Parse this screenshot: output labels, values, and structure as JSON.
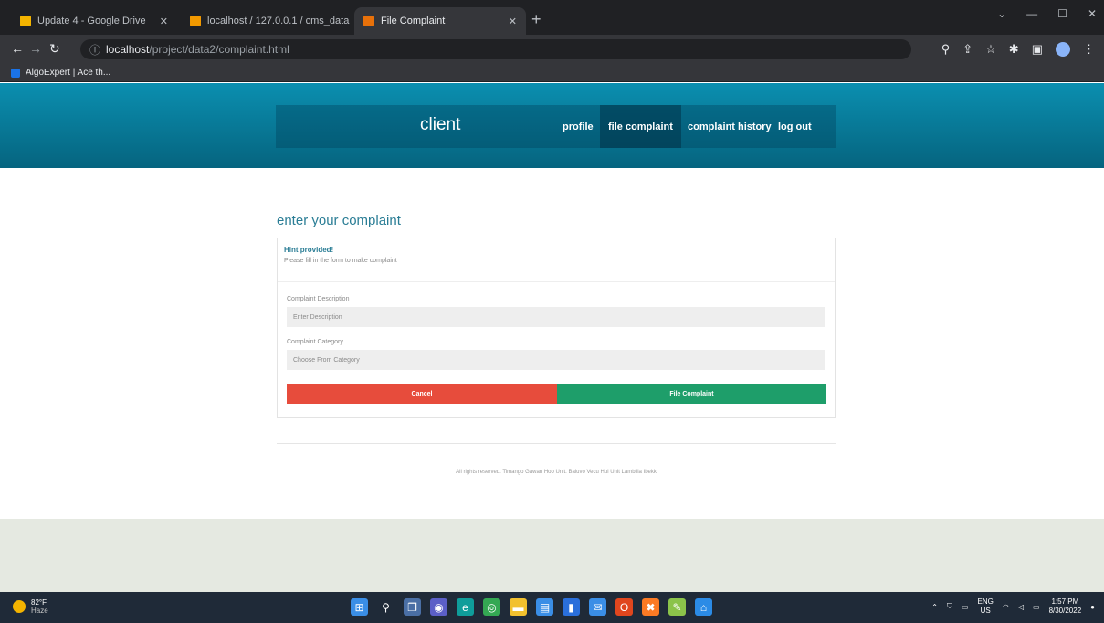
{
  "browser": {
    "tabs": [
      {
        "title": "Update 4 - Google Drive",
        "fav_color": "#f4b400"
      },
      {
        "title": "localhost / 127.0.0.1 / cms_data / ...",
        "fav_color": "#f29900"
      },
      {
        "title": "File Complaint",
        "fav_color": "#e8710a"
      }
    ],
    "new_tab_glyph": "+",
    "url_host": "localhost",
    "url_path": "/project/data2/complaint.html",
    "bookmark": "AlgoExpert | Ace th..."
  },
  "header": {
    "brand": "client",
    "nav": [
      {
        "label": "profile",
        "active": false
      },
      {
        "label": "file complaint",
        "active": true
      },
      {
        "label": "complaint history",
        "active": false
      },
      {
        "label": "log out",
        "active": false
      }
    ]
  },
  "main": {
    "title": "enter your complaint",
    "notice_heading": "Hint provided!",
    "notice_text": "Please fill in the form to make complaint",
    "description_label": "Complaint Description",
    "description_placeholder": "Enter Description",
    "category_label": "Complaint Category",
    "category_value": "Choose From Category",
    "cancel_label": "Cancel",
    "file_label": "File Complaint"
  },
  "footer": {
    "text": "All rights reserved. Timango Gawan Hoo Unit. Baluvo Vecu Hui Unit Lambilia Ibekk"
  },
  "taskbar": {
    "temp": "82°F",
    "weather": "Haze",
    "lang_top": "ENG",
    "lang_bottom": "US",
    "time": "1:57 PM",
    "date": "8/30/2022",
    "icons": [
      {
        "name": "windows-start",
        "color": "#3a8ee6"
      },
      {
        "name": "search",
        "color": "#1f2a38"
      },
      {
        "name": "task-view",
        "color": "#4a6fa5"
      },
      {
        "name": "chat",
        "color": "#5b5fc7"
      },
      {
        "name": "edge",
        "color": "#0f9d9a"
      },
      {
        "name": "chrome",
        "color": "#34a853"
      },
      {
        "name": "file-explorer",
        "color": "#f2c12e"
      },
      {
        "name": "store",
        "color": "#3a8ee6"
      },
      {
        "name": "notes",
        "color": "#2a6fdb"
      },
      {
        "name": "mail",
        "color": "#3a8ee6"
      },
      {
        "name": "office",
        "color": "#e0461e"
      },
      {
        "name": "xampp",
        "color": "#fb7a24"
      },
      {
        "name": "paint",
        "color": "#8bc34a"
      },
      {
        "name": "vscode",
        "color": "#2b8be6"
      }
    ]
  }
}
